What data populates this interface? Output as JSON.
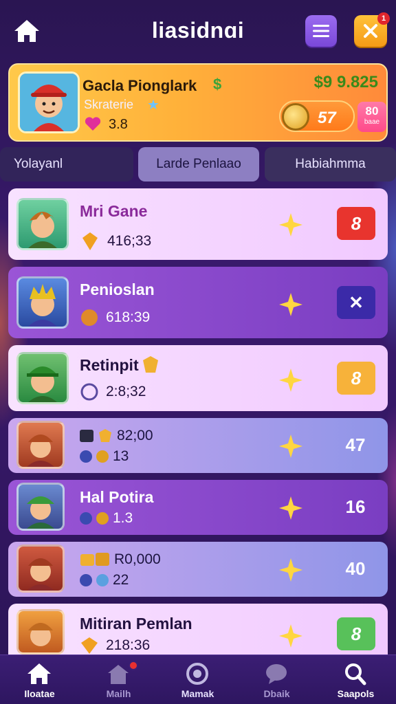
{
  "header": {
    "title": "liasidnɑi",
    "notification_count": "1"
  },
  "profile": {
    "name": "Gacla Pionglark",
    "name_badge": "$",
    "subtitle": "Skraterie",
    "rating": "3.8",
    "coins": "$9 9.825",
    "coin_count": "57",
    "badge_number": "80",
    "badge_text": "baae"
  },
  "tabs": [
    {
      "label": "Yolayanl"
    },
    {
      "label": "Larde Penlaao"
    },
    {
      "label": "Habiahmma"
    }
  ],
  "rows": [
    {
      "title": "Mri Gane",
      "value": "416;33",
      "action_label": "8",
      "action_color": "#e8342e"
    },
    {
      "title": "Penioslan",
      "value": "618:39",
      "action_label": "✕",
      "action_color": "#3b2aa8"
    },
    {
      "title": "Retinpit",
      "value": "2:8;32",
      "action_label": "8",
      "action_color": "#f7b23a"
    },
    {
      "title": "82;00",
      "value": "13",
      "score": "47"
    },
    {
      "title": "Hal Potira",
      "value": "1.3",
      "score": "16"
    },
    {
      "title": "R0,000",
      "value": "22",
      "score": "40"
    },
    {
      "title": "Mitiran Pemlan",
      "value": "218:36",
      "action_label": "8",
      "action_color": "#58c15a"
    }
  ],
  "nav": [
    {
      "label": "Iloatae"
    },
    {
      "label": "Mailh"
    },
    {
      "label": "Mamak"
    },
    {
      "label": "Dbaik"
    },
    {
      "label": "Saapols"
    }
  ],
  "colors": {
    "background": "#2a1552",
    "accent_orange": "#ffb13a",
    "accent_purple": "#9a55d6"
  }
}
